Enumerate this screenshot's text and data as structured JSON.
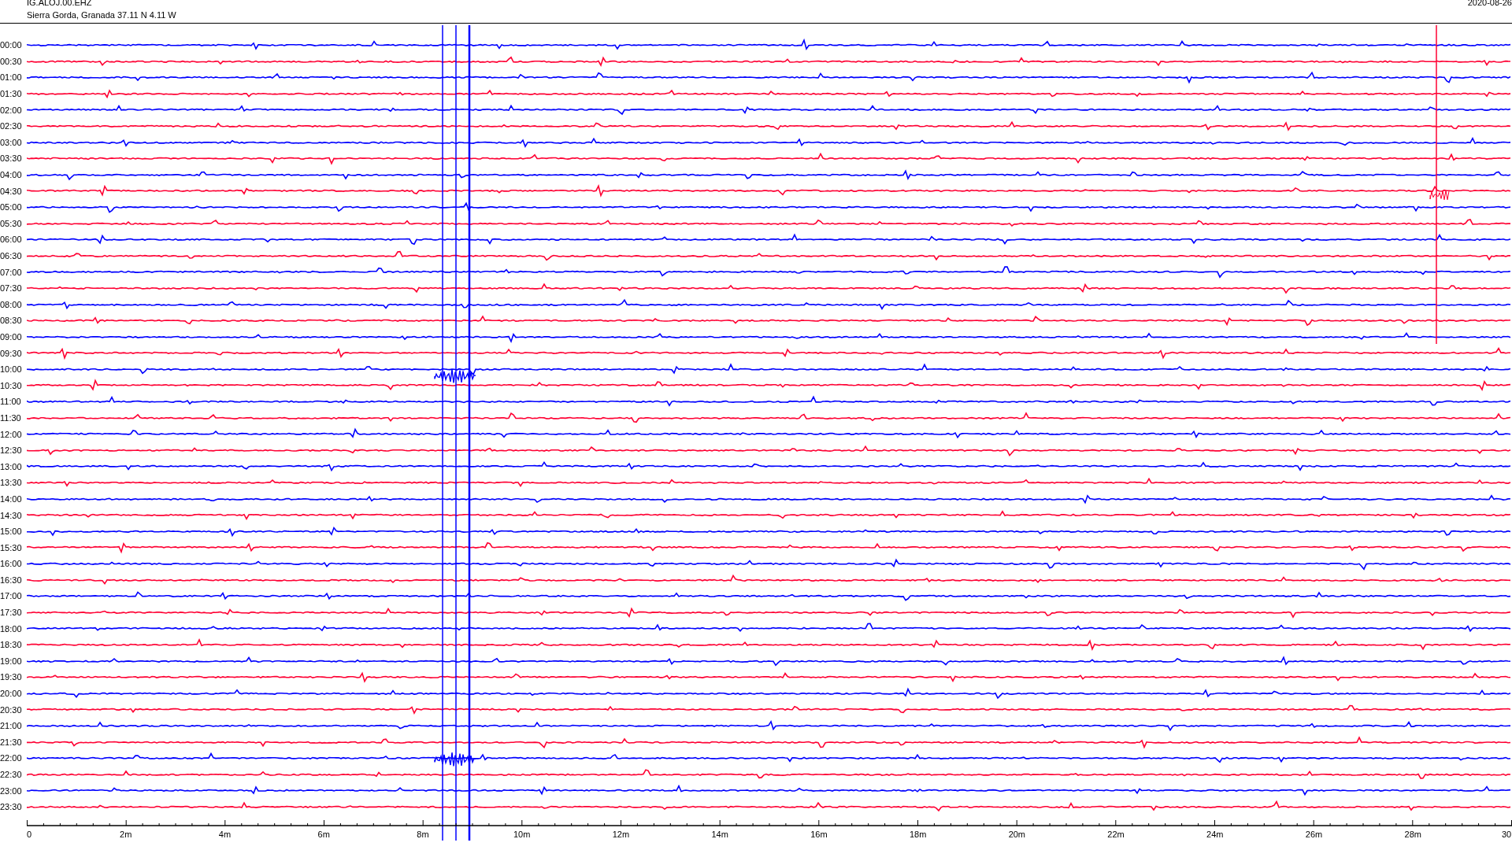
{
  "header": {
    "station": "IG.ALOJ.00.EHZ",
    "location": "Sierra Gorda, Granada  37.11 N 4.11 W",
    "date": "2020-08-26"
  },
  "rows": [
    {
      "time": "00:00",
      "color": "#0000ff"
    },
    {
      "time": "00:30",
      "color": "#ff0033"
    },
    {
      "time": "01:00",
      "color": "#0000ff"
    },
    {
      "time": "01:30",
      "color": "#ff0033"
    },
    {
      "time": "02:00",
      "color": "#0000ff"
    },
    {
      "time": "02:30",
      "color": "#ff0033"
    },
    {
      "time": "03:00",
      "color": "#0000ff"
    },
    {
      "time": "03:30",
      "color": "#ff0033"
    },
    {
      "time": "04:00",
      "color": "#0000ff"
    },
    {
      "time": "04:30",
      "color": "#ff0033"
    },
    {
      "time": "05:00",
      "color": "#0000ff"
    },
    {
      "time": "05:30",
      "color": "#ff0033"
    },
    {
      "time": "06:00",
      "color": "#0000ff"
    },
    {
      "time": "06:30",
      "color": "#ff0033"
    },
    {
      "time": "07:00",
      "color": "#0000ff"
    },
    {
      "time": "07:30",
      "color": "#ff0033"
    },
    {
      "time": "08:00",
      "color": "#0000ff"
    },
    {
      "time": "08:30",
      "color": "#ff0033"
    },
    {
      "time": "09:00",
      "color": "#0000ff"
    },
    {
      "time": "09:30",
      "color": "#ff0033"
    },
    {
      "time": "10:00",
      "color": "#0000ff"
    },
    {
      "time": "10:30",
      "color": "#ff0033"
    },
    {
      "time": "11:00",
      "color": "#0000ff"
    },
    {
      "time": "11:30",
      "color": "#ff0033"
    },
    {
      "time": "12:00",
      "color": "#0000ff"
    },
    {
      "time": "12:30",
      "color": "#ff0033"
    },
    {
      "time": "13:00",
      "color": "#0000ff"
    },
    {
      "time": "13:30",
      "color": "#ff0033"
    },
    {
      "time": "14:00",
      "color": "#0000ff"
    },
    {
      "time": "14:30",
      "color": "#ff0033"
    },
    {
      "time": "15:00",
      "color": "#0000ff"
    },
    {
      "time": "15:30",
      "color": "#ff0033"
    },
    {
      "time": "16:00",
      "color": "#0000ff"
    },
    {
      "time": "16:30",
      "color": "#ff0033"
    },
    {
      "time": "17:00",
      "color": "#0000ff"
    },
    {
      "time": "17:30",
      "color": "#ff0033"
    },
    {
      "time": "18:00",
      "color": "#0000ff"
    },
    {
      "time": "18:30",
      "color": "#ff0033"
    },
    {
      "time": "19:00",
      "color": "#0000ff"
    },
    {
      "time": "19:30",
      "color": "#ff0033"
    },
    {
      "time": "20:00",
      "color": "#0000ff"
    },
    {
      "time": "20:30",
      "color": "#ff0033"
    },
    {
      "time": "21:00",
      "color": "#0000ff"
    },
    {
      "time": "21:30",
      "color": "#ff0033"
    },
    {
      "time": "22:00",
      "color": "#0000ff"
    },
    {
      "time": "22:30",
      "color": "#ff0033"
    },
    {
      "time": "23:00",
      "color": "#0000ff"
    },
    {
      "time": "23:30",
      "color": "#ff0033"
    }
  ],
  "x_axis": {
    "labels": [
      "0",
      "2m",
      "4m",
      "6m",
      "8m",
      "10m",
      "12m",
      "14m",
      "16m",
      "18m",
      "20m",
      "22m",
      "24m",
      "26m",
      "28m",
      "30"
    ]
  }
}
